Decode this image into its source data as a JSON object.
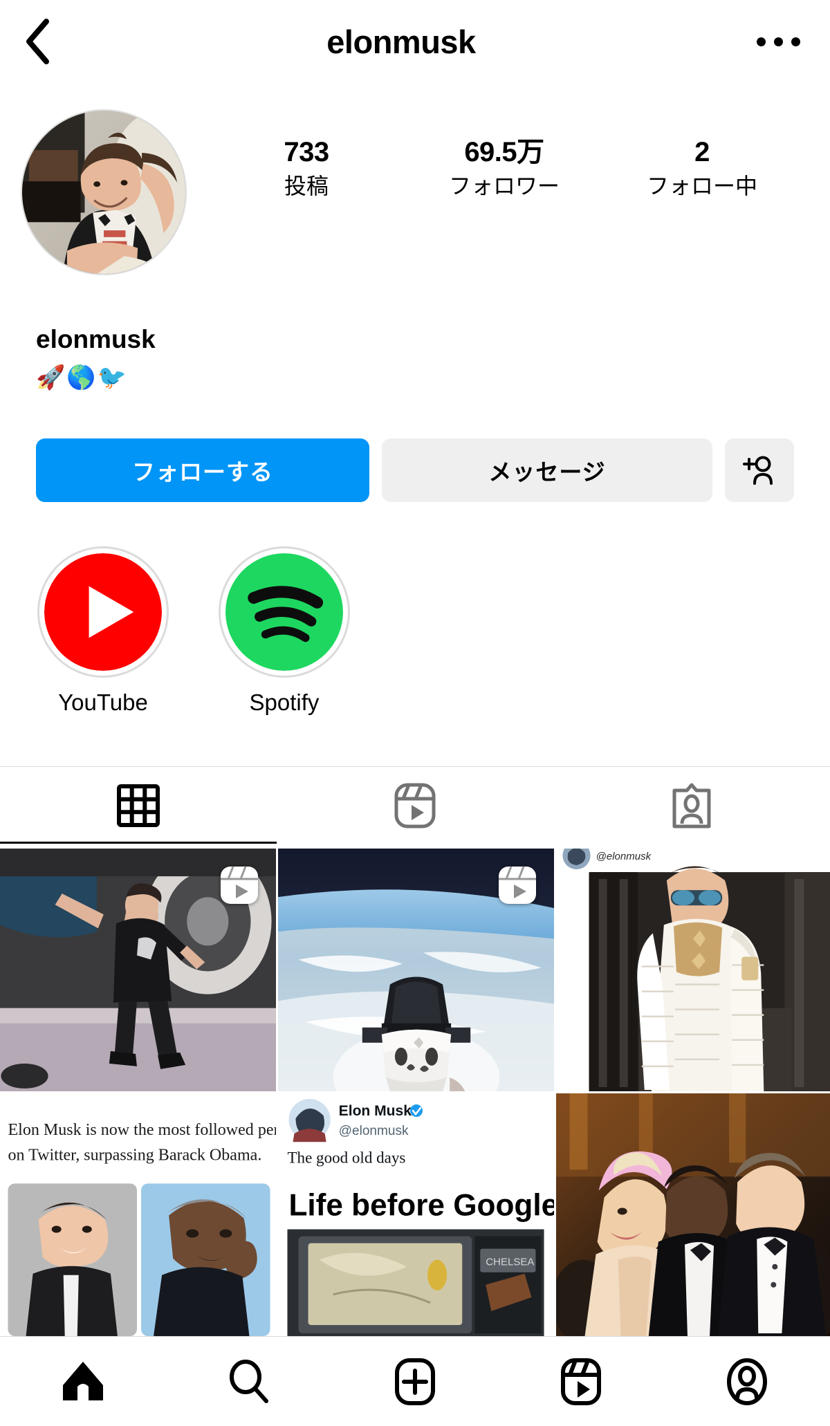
{
  "app": "Instagram",
  "topbar": {
    "back_icon": "chevron-left-icon",
    "title": "elonmusk",
    "more_icon": "more-horizontal-icon"
  },
  "profile": {
    "avatar_alt": "elonmusk profile photo",
    "username": "elonmusk",
    "bio": "🚀🌎🐦",
    "stats": [
      {
        "key": "posts",
        "value": "733",
        "label": "投稿"
      },
      {
        "key": "followers",
        "value": "69.5万",
        "label": "フォロワー"
      },
      {
        "key": "following",
        "value": "2",
        "label": "フォロー中"
      }
    ]
  },
  "actions": {
    "follow_label": "フォローする",
    "message_label": "メッセージ",
    "adduser_icon": "person-add-icon",
    "follow_color": "#0095F6",
    "secondary_color": "#EFEFEF"
  },
  "highlights": [
    {
      "label": "YouTube",
      "icon": "youtube-icon",
      "color": "#FF0000"
    },
    {
      "label": "Spotify",
      "icon": "spotify-icon",
      "color": "#1ED760"
    }
  ],
  "tabs": [
    {
      "key": "grid",
      "icon": "grid-icon",
      "active": true,
      "label": "投稿グリッド"
    },
    {
      "key": "reels",
      "icon": "reels-icon",
      "active": false,
      "label": "リール"
    },
    {
      "key": "tagged",
      "icon": "tagged-icon",
      "active": false,
      "label": "タグ付き"
    }
  ],
  "posts": [
    {
      "key": "post-1",
      "kind": "reel",
      "caption": "Elon dancing next to Tesla"
    },
    {
      "key": "post-2",
      "kind": "reel",
      "caption": "Dragon capsule above Earth"
    },
    {
      "key": "post-3",
      "kind": "image",
      "caption": "@elonmusk white puffer jacket",
      "overlay_handle": "@elonmusk"
    },
    {
      "key": "post-4",
      "kind": "image",
      "caption": "Elon Musk is now the most followed person on Twitter, surpassing Barack Obama.",
      "headline_line1": "Elon Musk is now the most followed person",
      "headline_line2": "on Twitter, surpassing Barack Obama."
    },
    {
      "key": "post-5",
      "kind": "image",
      "caption": "Life before Google Maps tweet",
      "tweet_name": "Elon Musk",
      "tweet_handle": "@elonmusk",
      "tweet_text": "The good old days",
      "meme_title": "Life before Google Maps"
    },
    {
      "key": "post-6",
      "kind": "image",
      "caption": "Met Gala red carpet"
    }
  ],
  "bottomnav": [
    {
      "key": "home",
      "icon": "home-icon",
      "active": true
    },
    {
      "key": "search",
      "icon": "search-icon",
      "active": false
    },
    {
      "key": "create",
      "icon": "plus-box-icon",
      "active": false
    },
    {
      "key": "reels",
      "icon": "reels-icon",
      "active": false
    },
    {
      "key": "profile",
      "icon": "profile-icon",
      "active": false
    }
  ]
}
